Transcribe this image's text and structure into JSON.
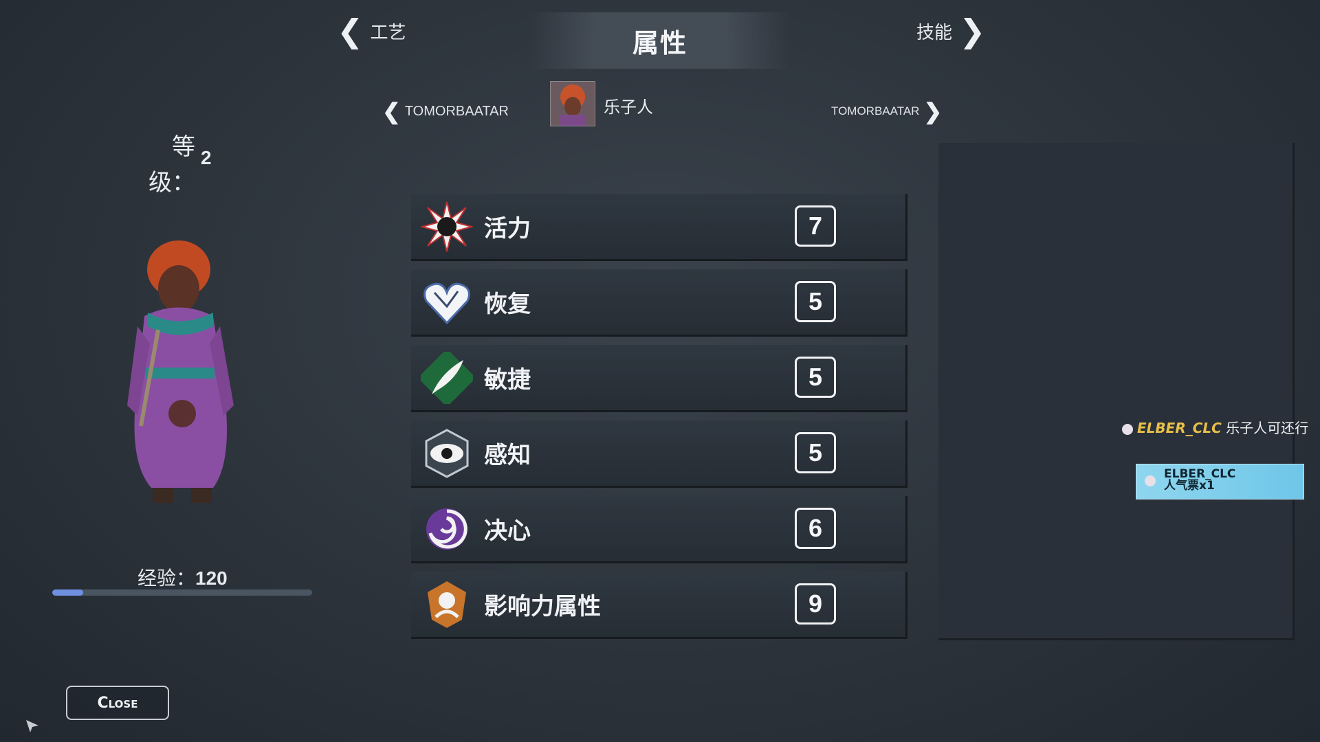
{
  "header": {
    "title": "属性",
    "prev_tab": "工艺",
    "next_tab": "技能"
  },
  "character": {
    "prev_name": "TOMORBAATAR",
    "next_name": "TOMORBAATAR",
    "current_name": "乐子人",
    "level_label_1": "等",
    "level_label_2": "级：",
    "level_value": "2",
    "exp_label": "经验：",
    "exp_value": "120",
    "exp_progress_fraction": 0.12
  },
  "stats": [
    {
      "label": "活力",
      "value": "7",
      "icon": "vitality-burst-icon"
    },
    {
      "label": "恢复",
      "value": "5",
      "icon": "recovery-heart-icon"
    },
    {
      "label": "敏捷",
      "value": "5",
      "icon": "agility-feather-icon"
    },
    {
      "label": "感知",
      "value": "5",
      "icon": "perception-eye-icon"
    },
    {
      "label": "决心",
      "value": "6",
      "icon": "resolve-swirl-icon"
    },
    {
      "label": "影响力属性",
      "value": "9",
      "icon": "influence-crest-icon"
    }
  ],
  "close_label": "Close",
  "chat": {
    "user": "ELBER_CLC",
    "message": "乐子人可还行",
    "gift_user": "ELBER_CLC",
    "gift_text": "人气票x1"
  },
  "colors": {
    "background": "#2c333b",
    "accent_exp": "#6f8fe0",
    "chat_username": "#e8c04a",
    "gift_bg": "#8fd6ef"
  }
}
